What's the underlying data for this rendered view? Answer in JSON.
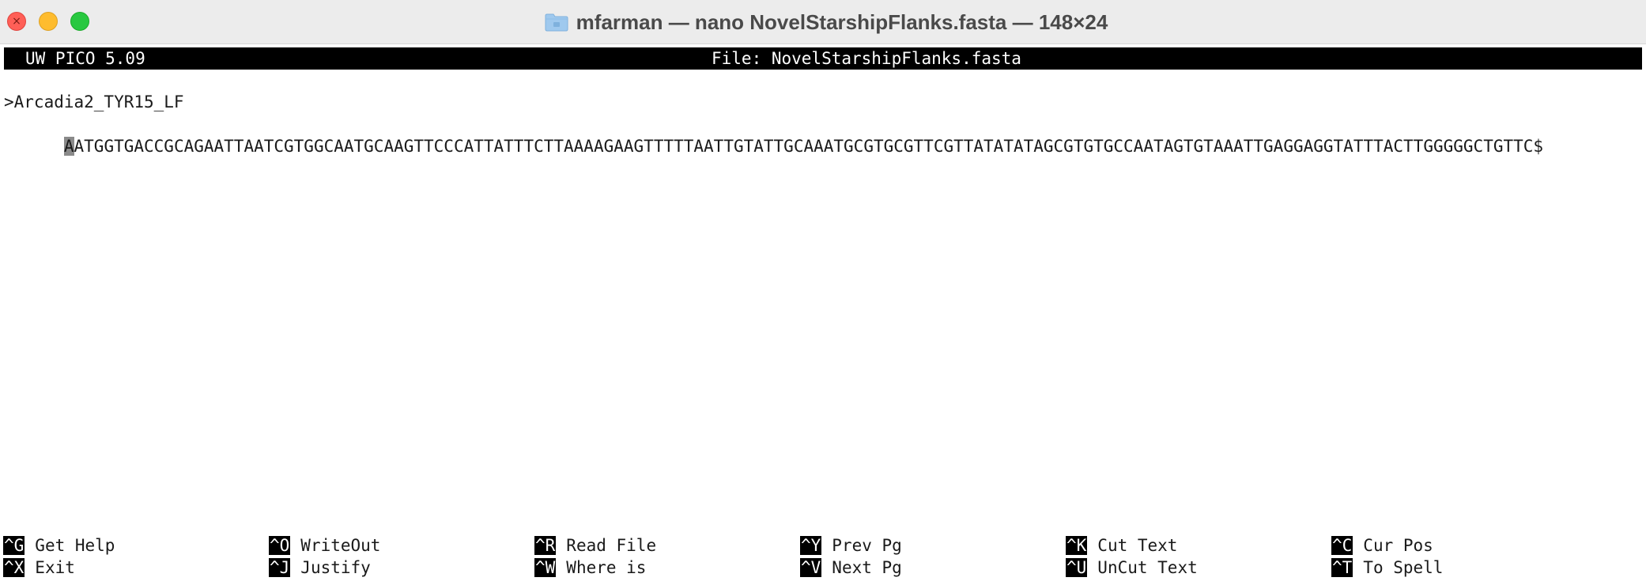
{
  "window": {
    "title": "mfarman — nano NovelStarshipFlanks.fasta — 148×24"
  },
  "editor": {
    "app_name": "UW PICO 5.09",
    "file_label": "File: NovelStarshipFlanks.fasta"
  },
  "content": {
    "lines": [
      ">Arcadia2_TYR15_LF",
      "AATGGTGACCGCAGAATTAATCGTGGCAATGCAAGTTCCCATTATTTCTTAAAAGAAGTTTTTAATTGTATTGCAAATGCGTGCGTTCGTTATATATAGCGTGTGCCAATAGTGTAAATTGAGGAGGTATTTACTTGGGGGCTGTTC$"
    ],
    "cursor_char": "A",
    "sequence_rest": "ATGGTGACCGCAGAATTAATCGTGGCAATGCAAGTTCCCATTATTTCTTAAAAGAAGTTTTTAATTGTATTGCAAATGCGTGCGTTCGTTATATATAGCGTGTGCCAATAGTGTAAATTGAGGAGGTATTTACTTGGGGGCTGTTC$"
  },
  "shortcuts": {
    "row1": [
      {
        "key": "^G",
        "label": "Get Help"
      },
      {
        "key": "^O",
        "label": "WriteOut"
      },
      {
        "key": "^R",
        "label": "Read File"
      },
      {
        "key": "^Y",
        "label": "Prev Pg"
      },
      {
        "key": "^K",
        "label": "Cut Text"
      },
      {
        "key": "^C",
        "label": "Cur Pos"
      }
    ],
    "row2": [
      {
        "key": "^X",
        "label": "Exit"
      },
      {
        "key": "^J",
        "label": "Justify"
      },
      {
        "key": "^W",
        "label": "Where is"
      },
      {
        "key": "^V",
        "label": "Next Pg"
      },
      {
        "key": "^U",
        "label": "UnCut Text"
      },
      {
        "key": "^T",
        "label": "To Spell"
      }
    ]
  },
  "colors": {
    "close": "#ff5f57",
    "minimize": "#febc2e",
    "maximize": "#28c840",
    "highlight_bar": "#000000",
    "cursor": "#8a8a8a"
  }
}
